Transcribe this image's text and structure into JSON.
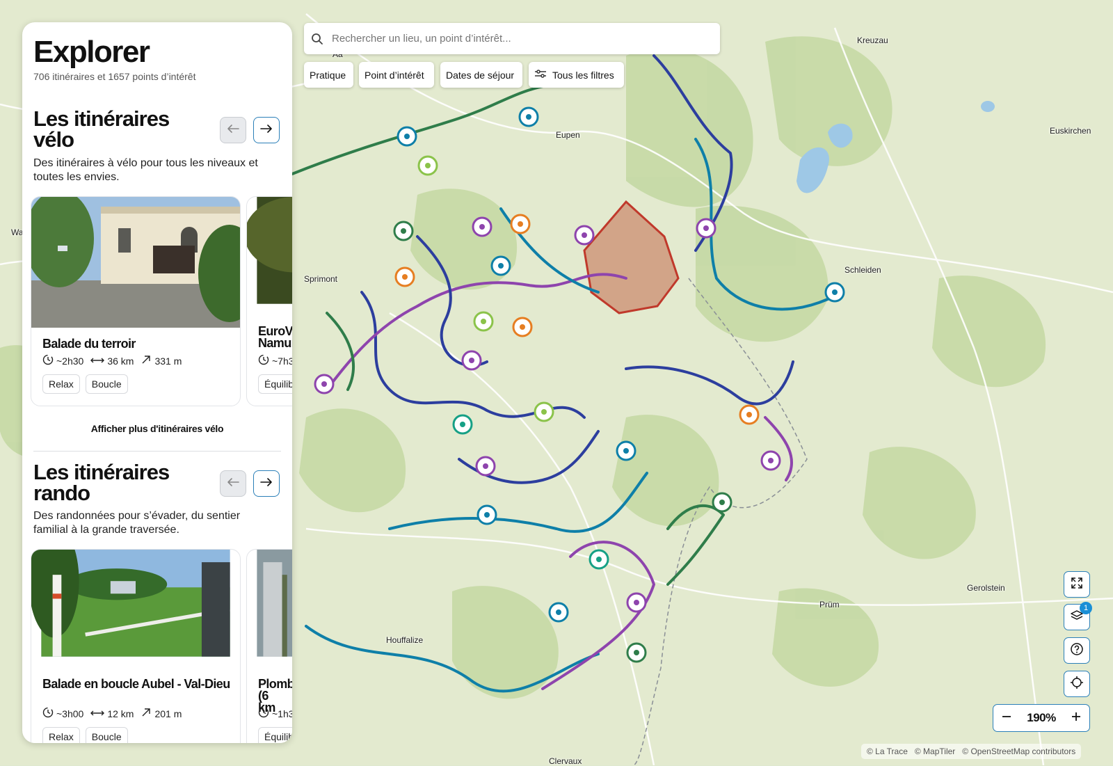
{
  "search": {
    "placeholder": "Rechercher un lieu, un point d’intérêt..."
  },
  "filters": [
    "Pratique",
    "Point d’intérêt",
    "Dates de séjour",
    "Tous les filtres"
  ],
  "panel": {
    "title": "Explorer",
    "subtitle": "706 itinéraires et 1657 points d’intérêt",
    "sections": [
      {
        "title": "Les itinéraires vélo",
        "description": "Des itinéraires à vélo pour tous les niveaux et toutes les envies.",
        "cards": [
          {
            "title": "Balade du terroir",
            "duration": "~2h30",
            "distance": "36 km",
            "elevation": "331 m",
            "tags": [
              "Relax",
              "Boucle"
            ]
          },
          {
            "title": "EuroVelo Namur",
            "duration": "~7h3",
            "tags": [
              "Équilib"
            ]
          }
        ],
        "more": "Afficher plus d'itinéraires vélo"
      },
      {
        "title": "Les itinéraires rando",
        "description": "Des randonnées pour s’évader, du sentier familial à la grande traversée.",
        "cards": [
          {
            "title": "Balade en boucle Aubel - Val-Dieu",
            "duration": "~3h00",
            "distance": "12 km",
            "elevation": "201 m",
            "tags": [
              "Relax",
              "Boucle"
            ]
          },
          {
            "title": "Plomb (6 km",
            "duration": "~1h3",
            "tags": [
              "Équilib"
            ]
          }
        ]
      }
    ]
  },
  "map": {
    "places": [
      "Kreuzau",
      "Euskirchen",
      "Eupen",
      "Sprimont",
      "Schleiden",
      "Wa",
      "Gerolstein",
      "Prüm",
      "Houffalize",
      "Clervaux",
      "Aa"
    ],
    "zoom": "190%",
    "layers_badge": "1",
    "attribution": [
      "© La Trace",
      "© MapTiler",
      "© OpenStreetMap contributors"
    ]
  },
  "colors": {
    "accent": "#2a7fb8",
    "cycling": "#0e7fa8",
    "hiking": "#8e44ad",
    "route_blue": "#2c3e9e",
    "route_green": "#2f7d4a",
    "restricted": "#c0392b"
  }
}
